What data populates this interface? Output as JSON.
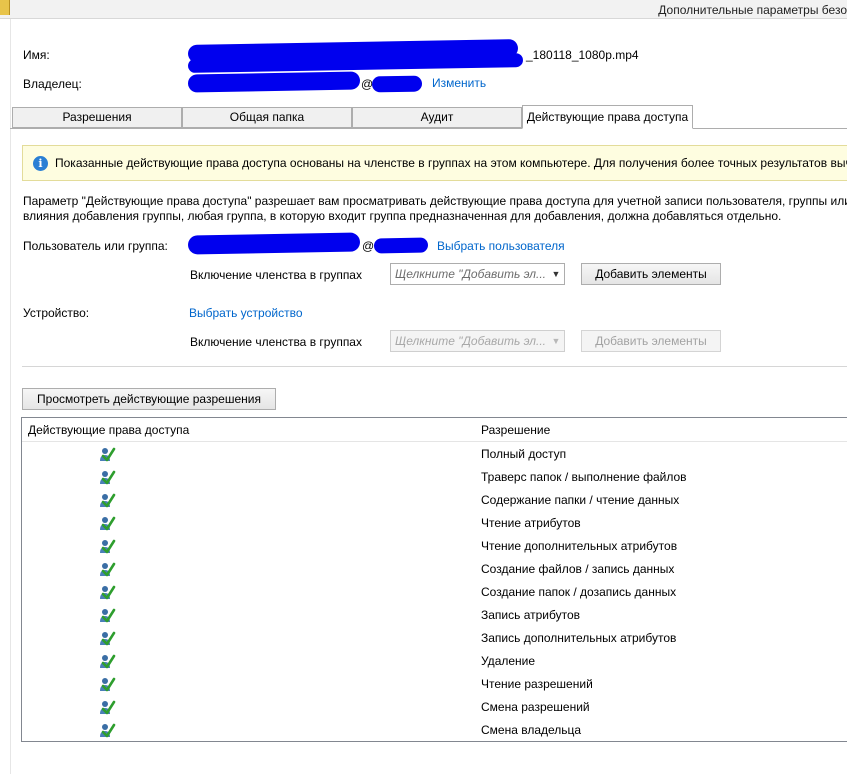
{
  "window": {
    "title": "Дополнительные параметры безо"
  },
  "file": {
    "name_label": "Имя:",
    "name_value_suffix": "_180118_1080p.mp4",
    "owner_label": "Владелец:",
    "owner_at": "@",
    "owner_change_link": "Изменить"
  },
  "tabs": [
    {
      "label": "Разрешения",
      "active": false
    },
    {
      "label": "Общая папка",
      "active": false
    },
    {
      "label": "Аудит",
      "active": false
    },
    {
      "label": "Действующие права доступа",
      "active": true
    }
  ],
  "info_bar": {
    "icon": "info-icon",
    "text": "Показанные действующие права доступа основаны на членстве в группах на этом компьютере. Для получения более точных результатов выч"
  },
  "description": {
    "line1": "Параметр \"Действующие права доступа\" разрешает вам просматривать действующие права доступа для учетной записи пользователя, группы или у",
    "line2": "влияния добавления группы, любая группа, в которую входит группа предназначенная для добавления, должна добавляться отдельно."
  },
  "user_group": {
    "label": "Пользователь или группа:",
    "at": "@",
    "select_link": "Выбрать пользователя",
    "membership_label": "Включение членства в группах",
    "combo_placeholder": "Щелкните \"Добавить эл...",
    "add_button": "Добавить элементы"
  },
  "device": {
    "label": "Устройство:",
    "select_link": "Выбрать устройство",
    "membership_label": "Включение членства в группах",
    "combo_placeholder": "Щелкните \"Добавить эл...",
    "add_button": "Добавить элементы"
  },
  "view_button": "Просмотреть действующие разрешения",
  "grid": {
    "col1": "Действующие права доступа",
    "col2": "Разрешение",
    "rows": [
      {
        "permission": "Полный доступ",
        "allowed_icon": "check-user-icon"
      },
      {
        "permission": "Траверс папок / выполнение файлов",
        "allowed_icon": "check-user-icon"
      },
      {
        "permission": "Содержание папки / чтение данных",
        "allowed_icon": "check-user-icon"
      },
      {
        "permission": "Чтение атрибутов",
        "allowed_icon": "check-user-icon"
      },
      {
        "permission": "Чтение дополнительных атрибутов",
        "allowed_icon": "check-user-icon"
      },
      {
        "permission": "Создание файлов / запись данных",
        "allowed_icon": "check-user-icon"
      },
      {
        "permission": "Создание папок / дозапись данных",
        "allowed_icon": "check-user-icon"
      },
      {
        "permission": "Запись атрибутов",
        "allowed_icon": "check-user-icon"
      },
      {
        "permission": "Запись дополнительных атрибутов",
        "allowed_icon": "check-user-icon"
      },
      {
        "permission": "Удаление",
        "allowed_icon": "check-user-icon"
      },
      {
        "permission": "Чтение разрешений",
        "allowed_icon": "check-user-icon"
      },
      {
        "permission": "Смена разрешений",
        "allowed_icon": "check-user-icon"
      },
      {
        "permission": "Смена владельца",
        "allowed_icon": "check-user-icon"
      }
    ]
  },
  "colors": {
    "link": "#0066cc",
    "info_bg": "#fefde0",
    "redaction": "#0000ee",
    "check": "#2e9e2e"
  }
}
